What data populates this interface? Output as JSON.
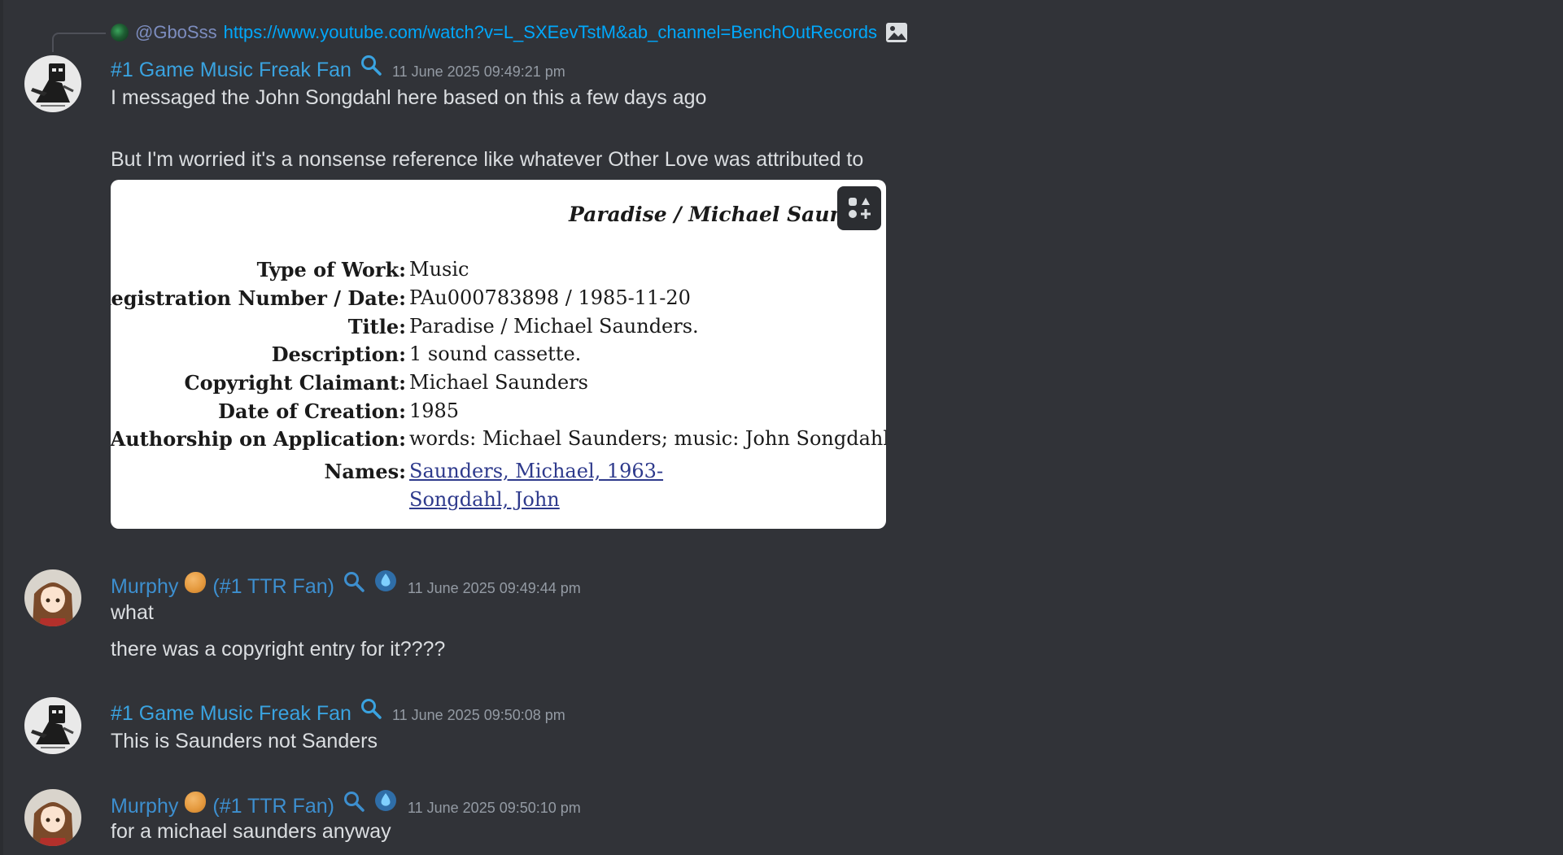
{
  "reply": {
    "mention": "@GboSss",
    "link": "https://www.youtube.com/watch?v=L_SXEevTstM&ab_channel=BenchOutRecords",
    "image_icon": "image-icon"
  },
  "messages": [
    {
      "username": "#1 Game Music Freak Fan",
      "timestamp": "11 June 2025 09:49:21 pm",
      "lines": [
        "I messaged the John Songdahl here based on this a few days ago",
        "But I'm worried it's a nonsense reference like whatever Other Love was attributed to"
      ]
    },
    {
      "username": "Murphy",
      "role_suffix": "(#1 TTR Fan)",
      "timestamp": "11 June 2025 09:49:44 pm",
      "lines": [
        "what",
        "there was a copyright entry for it????"
      ]
    },
    {
      "username": "#1 Game Music Freak Fan",
      "timestamp": "11 June 2025 09:50:08 pm",
      "lines": [
        "This is Saunders not Sanders"
      ]
    },
    {
      "username": "Murphy",
      "role_suffix": "(#1 TTR Fan)",
      "timestamp": "11 June 2025 09:50:10 pm",
      "lines": [
        "for a michael saunders anyway"
      ]
    }
  ],
  "embed": {
    "title": "Paradise / Michael Saunde",
    "rows": [
      {
        "label": "Type of Work:",
        "value": "Music"
      },
      {
        "label": "Registration Number / Date:",
        "value": "PAu000783898 / 1985-11-20"
      },
      {
        "label": "Title:",
        "value": "Paradise / Michael Saunders."
      },
      {
        "label": "Description:",
        "value": "1 sound cassette."
      },
      {
        "label": "Copyright Claimant:",
        "value": "Michael Saunders"
      },
      {
        "label": "Date of Creation:",
        "value": "1985"
      },
      {
        "label": "Authorship on Application:",
        "value": "words: Michael Saunders; music: John Songdahl."
      },
      {
        "label": "Names:",
        "value": "Saunders, Michael, 1963-"
      }
    ],
    "names_second": "Songdahl, John"
  },
  "colors": {
    "background": "#313338",
    "username_blue": "#3aa3e0",
    "link_blue": "#00a8fc",
    "timestamp_gray": "#949ba4",
    "text": "#dbdee1"
  }
}
